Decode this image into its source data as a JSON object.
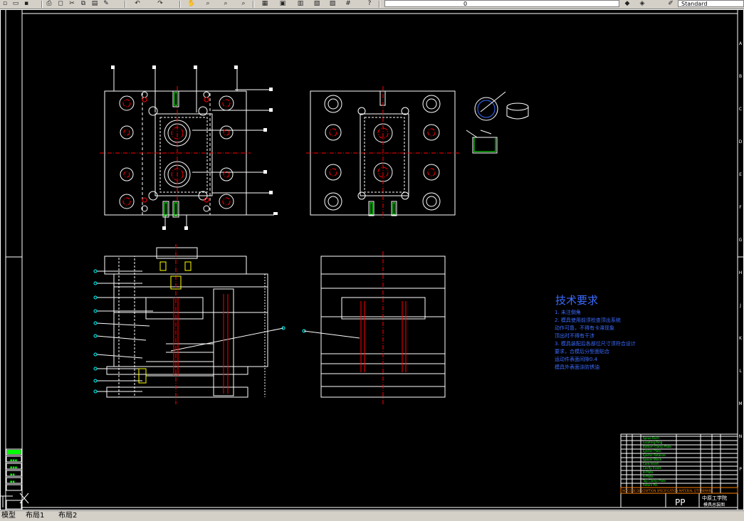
{
  "toolbar": {
    "layer_value": "0",
    "style_value": "Standard",
    "icons": [
      "new-file",
      "open",
      "save",
      "print",
      "preview",
      "cut",
      "copy",
      "paste",
      "match",
      "undo",
      "redo",
      "pan",
      "zoom-realtime",
      "zoom-window",
      "zoom-previous",
      "properties",
      "design-center",
      "tool-palettes",
      "markup",
      "calculator",
      "help",
      "layer-manager",
      "layer-state",
      "text-style"
    ]
  },
  "drawing": {
    "tech_title": "技术要求",
    "tech_notes": [
      "1. 未注倒角",
      "2. 模具使用前须检查顶出系统",
      "   动作可靠，不得有卡滞现象",
      "   顶出时不得有干涉",
      "3. 模具装配后各部位尺寸须符合设计",
      "   要求，合模后分型面贴合",
      "   运动件表面间隙0.4",
      "   模具外表面涂防锈油"
    ],
    "title_block": {
      "material": "PP",
      "school": "中原工学院",
      "drawing_name": "模具总装图"
    },
    "bom_rows": [
      "Sprue Bush",
      "Locating Ring",
      "Bottom Clamp Plate",
      "Ejector Plate",
      "Ejector Retainer",
      "Spacer Block",
      "Core Insert",
      "Cavity Insert",
      "B-Plate",
      "A-Plate",
      "Top Clamp Plate",
      "Return Pin"
    ],
    "bom_header": [
      "NO",
      "CODE",
      "DESCRIPTION",
      "SPECIFICATION",
      "MATERIAL",
      "QTY",
      "REMARK"
    ],
    "border_letters_right": [
      "A",
      "B",
      "C",
      "D",
      "E",
      "F",
      "G",
      "H",
      "J",
      "K",
      "L",
      "M",
      "N",
      "P"
    ]
  },
  "statusbar": {
    "tab_model": "模型",
    "tab_layout1": "布局1",
    "tab_layout2": "布局2"
  },
  "colors": {
    "background": "#000000",
    "lines": "#ffffff",
    "centerlines": "#ff0000",
    "hidden": "#00ffff",
    "bom_text": "#00ff00",
    "tech_text": "#3b6bff",
    "title_highlight": "#ff8000"
  }
}
